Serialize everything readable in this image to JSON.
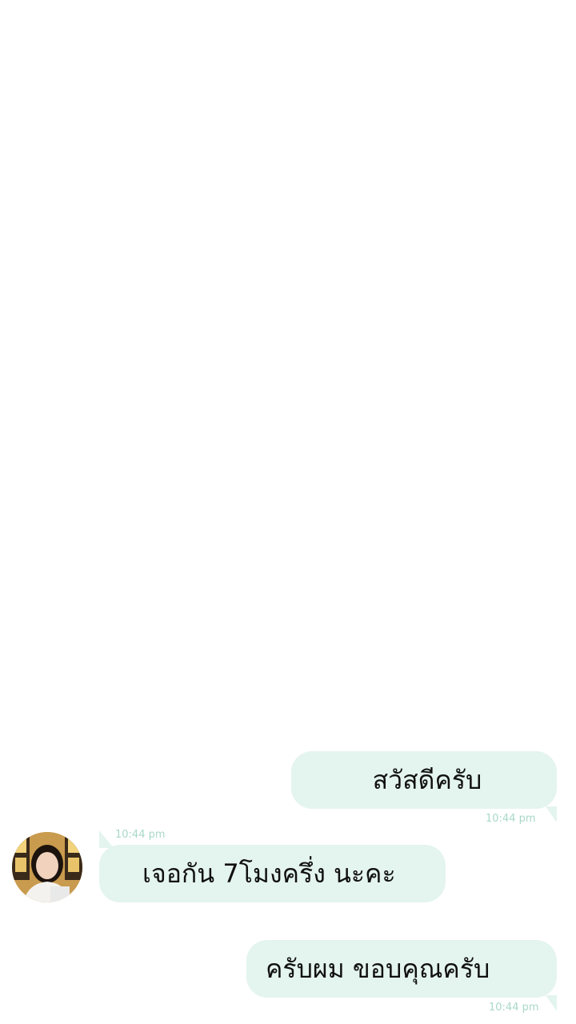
{
  "conversation": {
    "messages": [
      {
        "direction": "outgoing",
        "text": "สวัสดีครับ",
        "time": "10:44 pm"
      },
      {
        "direction": "incoming",
        "text": "เจอกัน 7โมงครึ่ง นะคะ",
        "time": "10:44 pm",
        "avatar": "contact-photo"
      },
      {
        "direction": "outgoing",
        "text": "ครับผม ขอบคุณครับ",
        "time": "10:44 pm"
      }
    ]
  },
  "colors": {
    "bubble": "#e4f4ee",
    "timestamp": "#a9d8c9",
    "background": "#ffffff",
    "text": "#111111"
  }
}
